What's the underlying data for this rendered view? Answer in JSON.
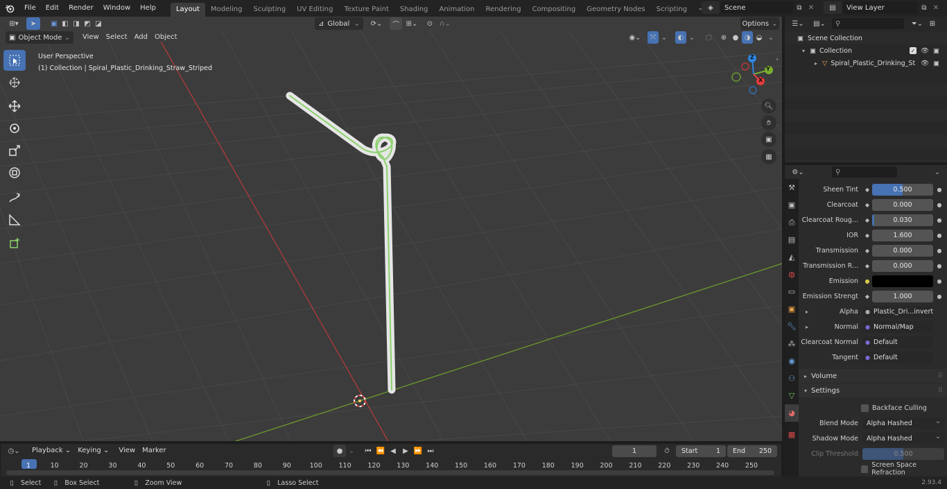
{
  "app": {
    "menus": [
      "File",
      "Edit",
      "Render",
      "Window",
      "Help"
    ],
    "workspaces": [
      "Layout",
      "Modeling",
      "Sculpting",
      "UV Editing",
      "Texture Paint",
      "Shading",
      "Animation",
      "Rendering",
      "Compositing",
      "Geometry Nodes",
      "Scripting"
    ],
    "active_workspace": "Layout",
    "scene_name": "Scene",
    "view_layer": "View Layer",
    "version": "2.93.4"
  },
  "viewport_header": {
    "mode": "Object Mode",
    "menus": [
      "View",
      "Select",
      "Add",
      "Object"
    ],
    "transform_orientation": "Global",
    "options_label": "Options"
  },
  "viewport": {
    "perspective_label": "User Perspective",
    "collection_label": "(1) Collection | Spiral_Plastic_Drinking_Straw_Striped",
    "gizmo_axes": [
      "X",
      "Y",
      "Z"
    ]
  },
  "outliner": {
    "root": "Scene Collection",
    "collection": "Collection",
    "object": "Spiral_Plastic_Drinking_St"
  },
  "properties": {
    "rows": [
      {
        "label": "Sheen Tint",
        "value": "0.500",
        "fraction": 0.5,
        "kind": "number"
      },
      {
        "label": "Clearcoat",
        "value": "0.000",
        "fraction": 0,
        "kind": "number"
      },
      {
        "label": "Clearcoat Roug...",
        "value": "0.030",
        "fraction": 0.03,
        "kind": "number"
      },
      {
        "label": "IOR",
        "value": "1.600",
        "fraction": 0,
        "kind": "number"
      },
      {
        "label": "Transmission",
        "value": "0.000",
        "fraction": 0,
        "kind": "number"
      },
      {
        "label": "Transmission R...",
        "value": "0.000",
        "fraction": 0,
        "kind": "number"
      },
      {
        "label": "Emission",
        "value": "",
        "fraction": 0,
        "kind": "color"
      },
      {
        "label": "Emission Strengt",
        "value": "1.000",
        "fraction": 0,
        "kind": "number"
      },
      {
        "label": "Alpha",
        "value": "Plastic_Dri...invert.png",
        "kind": "link"
      },
      {
        "label": "Normal",
        "value": "Normal/Map",
        "kind": "link"
      },
      {
        "label": "Clearcoat Normal",
        "value": "Default",
        "kind": "link"
      },
      {
        "label": "Tangent",
        "value": "Default",
        "kind": "link"
      }
    ],
    "sections": {
      "volume": "Volume",
      "settings": "Settings"
    },
    "backface_culling": "Backface Culling",
    "blend_mode_label": "Blend Mode",
    "blend_mode_value": "Alpha Hashed",
    "shadow_mode_label": "Shadow Mode",
    "shadow_mode_value": "Alpha Hashed",
    "clip_threshold_label": "Clip Threshold",
    "clip_threshold_value": "0.500",
    "screen_space_refraction": "Screen Space Refraction"
  },
  "timeline": {
    "menus": [
      "Playback",
      "Keying",
      "View",
      "Marker"
    ],
    "current_frame": "1",
    "start_label": "Start",
    "start_value": "1",
    "end_label": "End",
    "end_value": "250",
    "ticks": [
      "1",
      "10",
      "20",
      "30",
      "40",
      "50",
      "60",
      "70",
      "80",
      "90",
      "100",
      "110",
      "120",
      "130",
      "140",
      "150",
      "160",
      "170",
      "180",
      "190",
      "200",
      "210",
      "220",
      "230",
      "240",
      "250"
    ]
  },
  "statusbar": {
    "select": "Select",
    "box_select": "Box Select",
    "zoom_view": "Zoom View",
    "lasso_select": "Lasso Select"
  },
  "colors": {
    "accent": "#4772b3",
    "x_axis": "#e23b3b",
    "y_axis": "#7aae2e",
    "z_axis": "#2e86e2"
  }
}
